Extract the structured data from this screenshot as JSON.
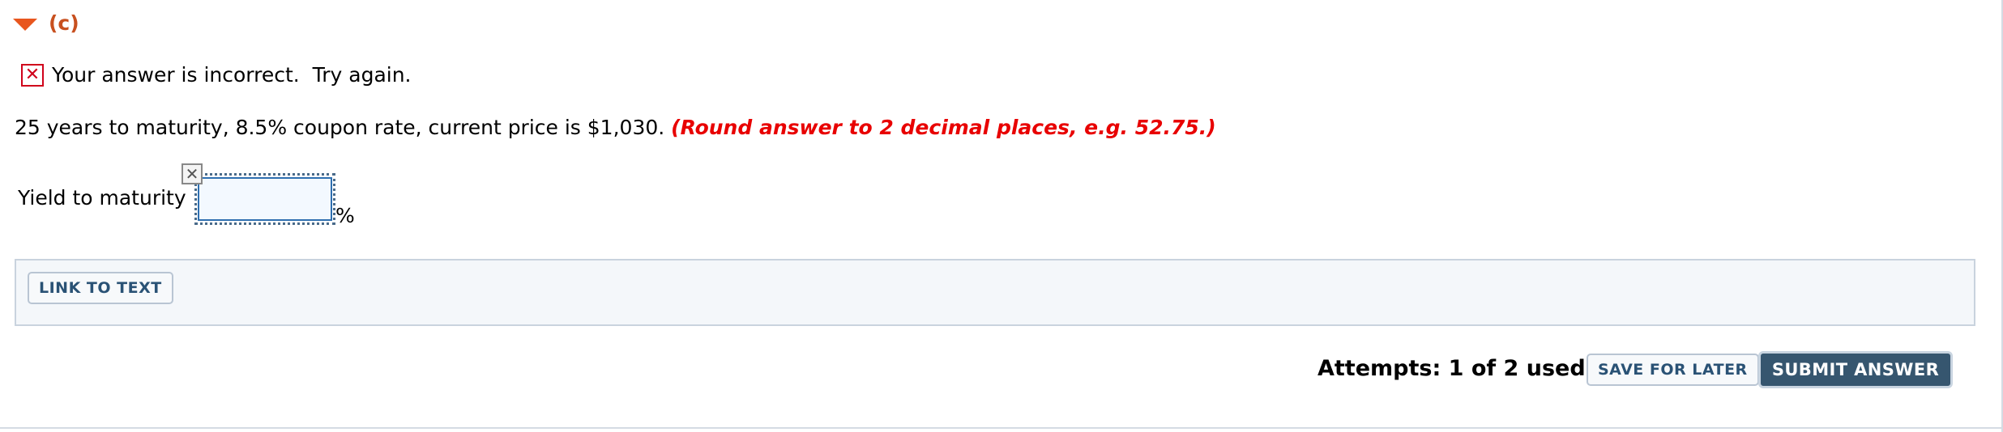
{
  "section": {
    "label": "(c)",
    "toggle_icon": "caret-down-icon",
    "accent_color": "#e8561e"
  },
  "feedback": {
    "icon": "incorrect-x-icon",
    "icon_glyph": "✕",
    "text": "Your answer is incorrect.  Try again.",
    "status_color": "#d0021b"
  },
  "question": {
    "text": "25 years to maturity, 8.5% coupon rate, current price is $1,030. ",
    "hint": "(Round answer to 2 decimal places, e.g. 52.75.)",
    "hint_color": "#e80000"
  },
  "answer": {
    "label": "Yield to maturity",
    "value": "",
    "unit": "%",
    "clear_icon": "clear-x-icon",
    "clear_glyph": "✕"
  },
  "links": {
    "link_to_text": "LINK TO TEXT"
  },
  "footer": {
    "attempts": "Attempts: 1 of 2 used",
    "save_label": "SAVE FOR LATER",
    "submit_label": "SUBMIT ANSWER",
    "submit_color": "#36566f"
  }
}
